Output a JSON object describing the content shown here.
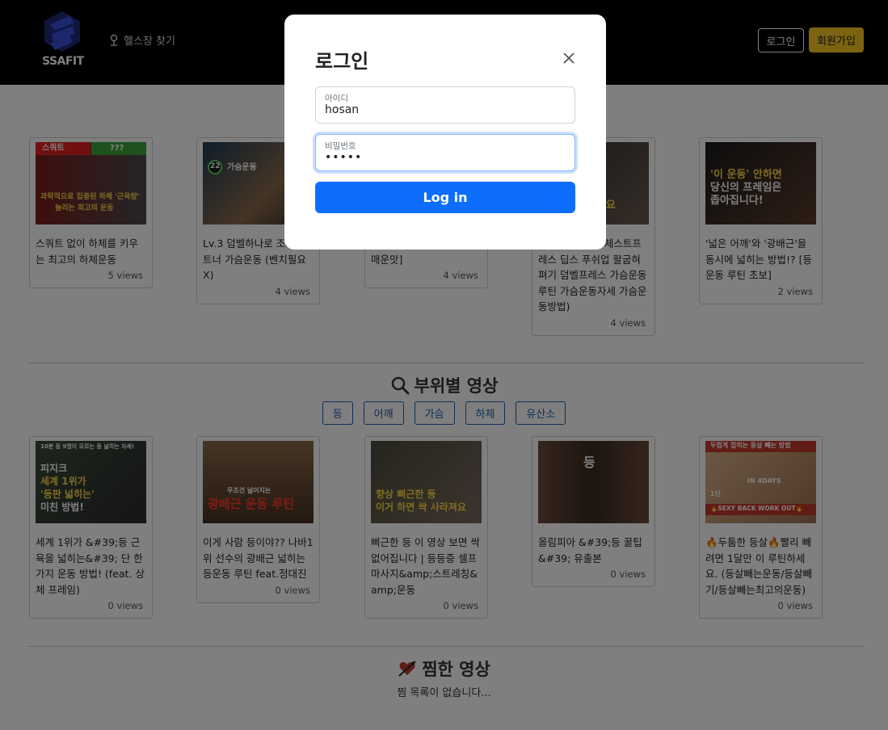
{
  "header": {
    "logo_text": "SSAFIT",
    "gym_link": "헬스장 찾기",
    "login_button": "로그인",
    "signup_button": "회원가입"
  },
  "top_videos": [
    {
      "title": "스쿼트 없이 하체를 키우는 최고의 하체운동",
      "views": "5 views",
      "thumb_text": [
        "스쿼트",
        "???",
        "과학적으로 입증된 하체 '근육량'",
        "늘리는 최고의 운동"
      ]
    },
    {
      "title": "Lv.3 덤벨하나로 조지는 트너 가슴운동 (벤치필요X)",
      "views": "4 views",
      "thumb_text": [
        "22",
        "가슴운동"
      ]
    },
    {
      "title": "고의 유산소운동 [칼소폭 매운맛]",
      "views": "4 views",
      "thumb_text": []
    },
    {
      "title": "면 (벤치프레스 체스트프레스 딥스 푸쉬업 팔굽혀펴기 덤벨프레스 가슴운동루틴 가슴운동자세 가슴운동방법)",
      "views": "4 views",
      "thumb_text": [
        "볼게요"
      ]
    },
    {
      "title": "'넓은 어깨'와 '광배근'을 동시에 넓히는 방법!? [등 운동 루틴 초보]",
      "views": "2 views",
      "thumb_text": [
        "'이 운동' 안하면",
        "당신의 프레임은",
        "좁아집니다!"
      ]
    }
  ],
  "category_section": {
    "title": "부위별 영상",
    "categories": [
      "등",
      "어깨",
      "가슴",
      "하체",
      "유산소"
    ]
  },
  "category_videos": [
    {
      "title": "세계 1위가 &#39;등 근육을 넓히는&#39; 단 한가지 운동 방법! (feat. 상체 프레임)",
      "views": "0 views",
      "thumb_text": [
        "10분 등 9명이 모르는 등 넓히는 자세!",
        "피지크",
        "세계 1위가",
        "'등판 넓히는'",
        "미친 방법!"
      ]
    },
    {
      "title": "이게 사람 등이야?? 나바1위 선수의 광배근 넓히는 등운동 루틴 feat.정대진",
      "views": "0 views",
      "thumb_text": [
        "무조건 넓어지는",
        "광배근 운동 루틴"
      ]
    },
    {
      "title": "삐근한 등 이 영상 보면 싹 없어집니다 | 등등증 셀프마사지&amp;스트레칭&amp;운동",
      "views": "0 views",
      "thumb_text": [
        "향상 삐근한 등",
        "이거 하면 싹 사라져요"
      ]
    },
    {
      "title": "올림피아 &#39;등 꿀팁&#39; 유출본",
      "views": "0 views",
      "thumb_text": [
        "등"
      ]
    },
    {
      "title": "🔥두툼한 등살🔥빨리 빼려면 1달만 이 루틴하세요. (등살빼는운동/등살빼기/등살빼는최고의운동)",
      "views": "0 views",
      "thumb_text": [
        "두껍게 접히는 등살 빼는 방법",
        "IN 4DAYS",
        "1단",
        "🔥SEXY BACK WORK OUT🔥"
      ]
    }
  ],
  "favorites_section": {
    "title": "찜한 영상",
    "empty_message": "찜 목록이 없습니다..."
  },
  "login_modal": {
    "title": "로그인",
    "id_label": "아이디",
    "id_value": "hosan",
    "password_label": "비밀번호",
    "password_value": "•••••",
    "submit_label": "Log in"
  },
  "colors": {
    "header_bg": "#000000",
    "signup_bg": "#f6c623",
    "category_border": "#1a5fb4",
    "primary_button": "#0d6efd"
  }
}
